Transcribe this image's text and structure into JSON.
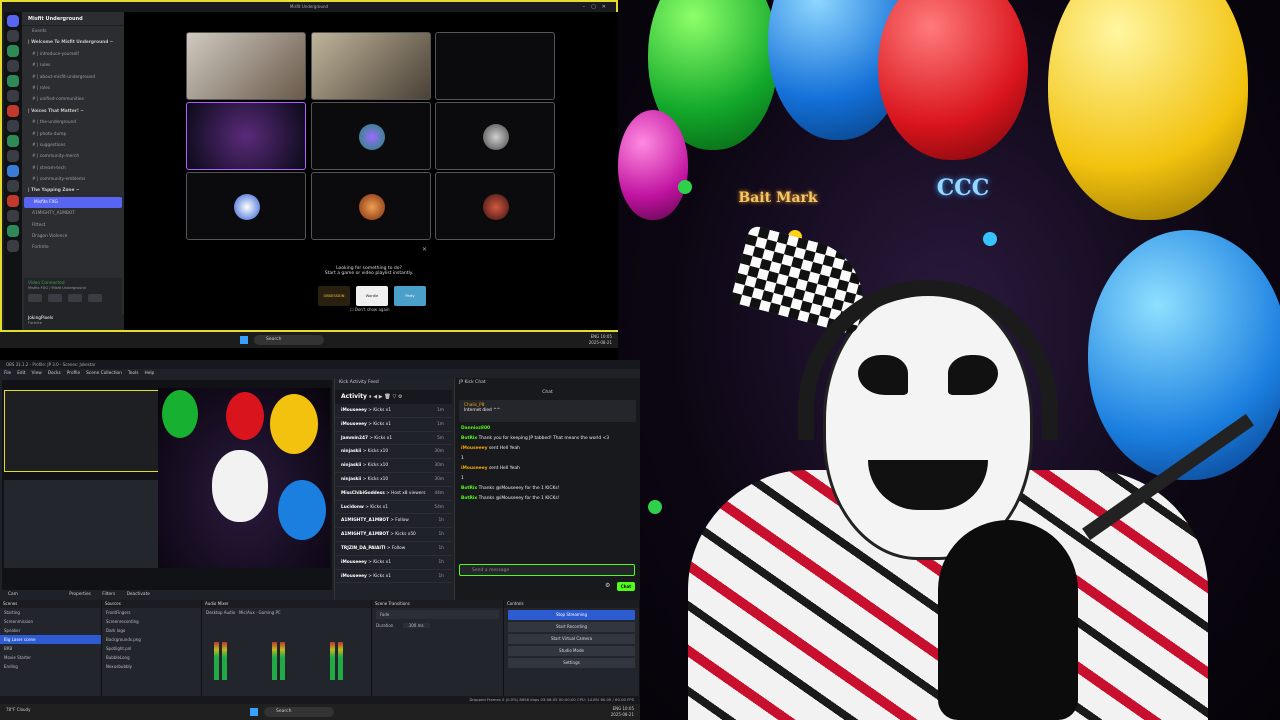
{
  "discord": {
    "title": "Misfit Underground",
    "server_name": "Misfit Underground",
    "channels": [
      {
        "label": "Events",
        "type": "item"
      },
      {
        "label": "| Welcome To Misfit Underground ~",
        "type": "cat"
      },
      {
        "label": "# | introduce-yourself",
        "type": "item"
      },
      {
        "label": "# | rules",
        "type": "item"
      },
      {
        "label": "# | about-misfit-underground",
        "type": "item"
      },
      {
        "label": "# | roles",
        "type": "item"
      },
      {
        "label": "# | unified-communities",
        "type": "item"
      },
      {
        "label": "| Voices That Matter! ~",
        "type": "cat"
      },
      {
        "label": "# | the-underground",
        "type": "item"
      },
      {
        "label": "# | photo-dump",
        "type": "item"
      },
      {
        "label": "# | suggestions",
        "type": "item"
      },
      {
        "label": "# | community-merch",
        "type": "item"
      },
      {
        "label": "# | stream-tech",
        "type": "item"
      },
      {
        "label": "# | community-emblems",
        "type": "item"
      },
      {
        "label": "| The Yapping Zone ~",
        "type": "cat"
      },
      {
        "label": "Misfits FXG",
        "type": "live"
      },
      {
        "label": "A1MIGHTY_A1MBOT",
        "type": "item"
      },
      {
        "label": "Fittest",
        "type": "item"
      },
      {
        "label": "Dragon Violence",
        "type": "item"
      },
      {
        "label": "Fortnite",
        "type": "item"
      }
    ],
    "voice_status": "Video Connected",
    "voice_sub": "Misfits FXG / Misfit Underground",
    "user_name": "JokingPixels",
    "user_status": "Fortnite",
    "activity_title": "Looking for something to do?",
    "activity_sub": "Start a game or video playlist instantly.",
    "activity_cards": [
      "OBSESSION",
      "Wordle",
      "Party"
    ],
    "dont_show": "Don't show again"
  },
  "taskbar_top": {
    "search": "Search",
    "tray_lang": "ENG",
    "tray_time": "10:05",
    "tray_date": "2025-08-21"
  },
  "obs": {
    "title": "OBS 31.1.2 - Profile: JP 3.0 - Scenes: Jokestar",
    "menu": [
      "File",
      "Edit",
      "View",
      "Docks",
      "Profile",
      "Scene Collection",
      "Tools",
      "Help"
    ],
    "toolbar": [
      "Cam",
      "Properties",
      "Filters",
      "Deactivate"
    ],
    "activity_dock_title": "Kick Activity Feed",
    "activity_label": "Activity",
    "feed": [
      {
        "user": "iMouseeey",
        "action": "> Kicks x1",
        "time": "1m"
      },
      {
        "user": "iMouseeey",
        "action": "> Kicks x1",
        "time": "1m"
      },
      {
        "user": "Jammin247",
        "action": "> Kicks x1",
        "time": "5m"
      },
      {
        "user": "ninjaskii",
        "action": "> Kicks x10",
        "time": "30m"
      },
      {
        "user": "ninjaskii",
        "action": "> Kicks x10",
        "time": "30m"
      },
      {
        "user": "ninjaskii",
        "action": "> Kicks x10",
        "time": "30m"
      },
      {
        "user": "MissChibiGoddess",
        "action": "> Host x8 viewers",
        "time": "44m"
      },
      {
        "user": "Lucidonw",
        "action": "> Kicks x1",
        "time": "54m"
      },
      {
        "user": "A1MIGHTY_A1MBOT",
        "action": "> Follow",
        "time": "1h"
      },
      {
        "user": "A1MIGHTY_A1MBOT",
        "action": "> Kicks x50",
        "time": "1h"
      },
      {
        "user": "TRJZIN_DA_PAIAITI",
        "action": "> Follow",
        "time": "1h"
      },
      {
        "user": "iMouseeey",
        "action": "> Kicks x1",
        "time": "1h"
      },
      {
        "user": "iMouseeey",
        "action": "> Kicks x1",
        "time": "1h"
      }
    ],
    "kick_dock_title": "JP Kick Chat",
    "chat_label": "Chat",
    "pinned_by": "Chalis_P8",
    "pinned_text": "Internet died ^^",
    "messages": [
      {
        "user": "Dannioz800",
        "text": ""
      },
      {
        "user": "BotRix",
        "text": "Thank you for keeping JP tabbed! That means the world <3"
      },
      {
        "user": "iMouseeey",
        "text": "sent Hell Yeah"
      },
      {
        "user": "",
        "text": "1"
      },
      {
        "user": "iMouseeey",
        "text": "sent Hell Yeah"
      },
      {
        "user": "",
        "text": "1"
      },
      {
        "user": "BotRix",
        "text": "Thanks @iMouseeey for the 1 KICKs!"
      },
      {
        "user": "BotRix",
        "text": "Thanks @iMouseeey for the 1 KICKs!"
      }
    ],
    "chat_placeholder": "Send a message",
    "chat_button": "Chat",
    "scenes_title": "Scenes",
    "scenes": [
      "Starting",
      "Screenmission",
      "Speaker",
      "Big Laser scene",
      "BRB",
      "Movie Starter",
      "Ending"
    ],
    "sources_title": "Sources",
    "sources": [
      "FrontFingers",
      "Screenrecording",
      "Dark logo",
      "Backgrounds.png",
      "Spotlight.pnl",
      "BubbleLong",
      "Nexusbubbly"
    ],
    "mixer_title": "Audio Mixer",
    "mixer_channels": [
      "Desktop Audio",
      "Mic/Aux",
      "Gaming PC"
    ],
    "transitions_title": "Scene Transitions",
    "transition": "Fade",
    "duration_label": "Duration",
    "duration": "300 ms",
    "controls_title": "Controls",
    "controls": [
      "Stop Streaming",
      "Start Recording",
      "Start Virtual Camera",
      "Studio Mode",
      "Settings"
    ],
    "status": "Dropped Frames 0 (0.0%)   8656 kbps   03:08:05   00:00:00   CPU: 14.8%   60.00 / 60.00 FPS"
  },
  "taskbar_bottom": {
    "weather": "78°F Cloudy",
    "search": "Search",
    "tray_lang": "ENG",
    "tray_time": "10:05",
    "tray_date": "2025-08-21"
  },
  "stream": {
    "neon_left": "Bait Mark",
    "neon_right": "CCC"
  },
  "colors": {
    "discord_border": "#e6dc2b",
    "kick_green": "#53fc18",
    "obs_blue": "#2d5bd2"
  }
}
